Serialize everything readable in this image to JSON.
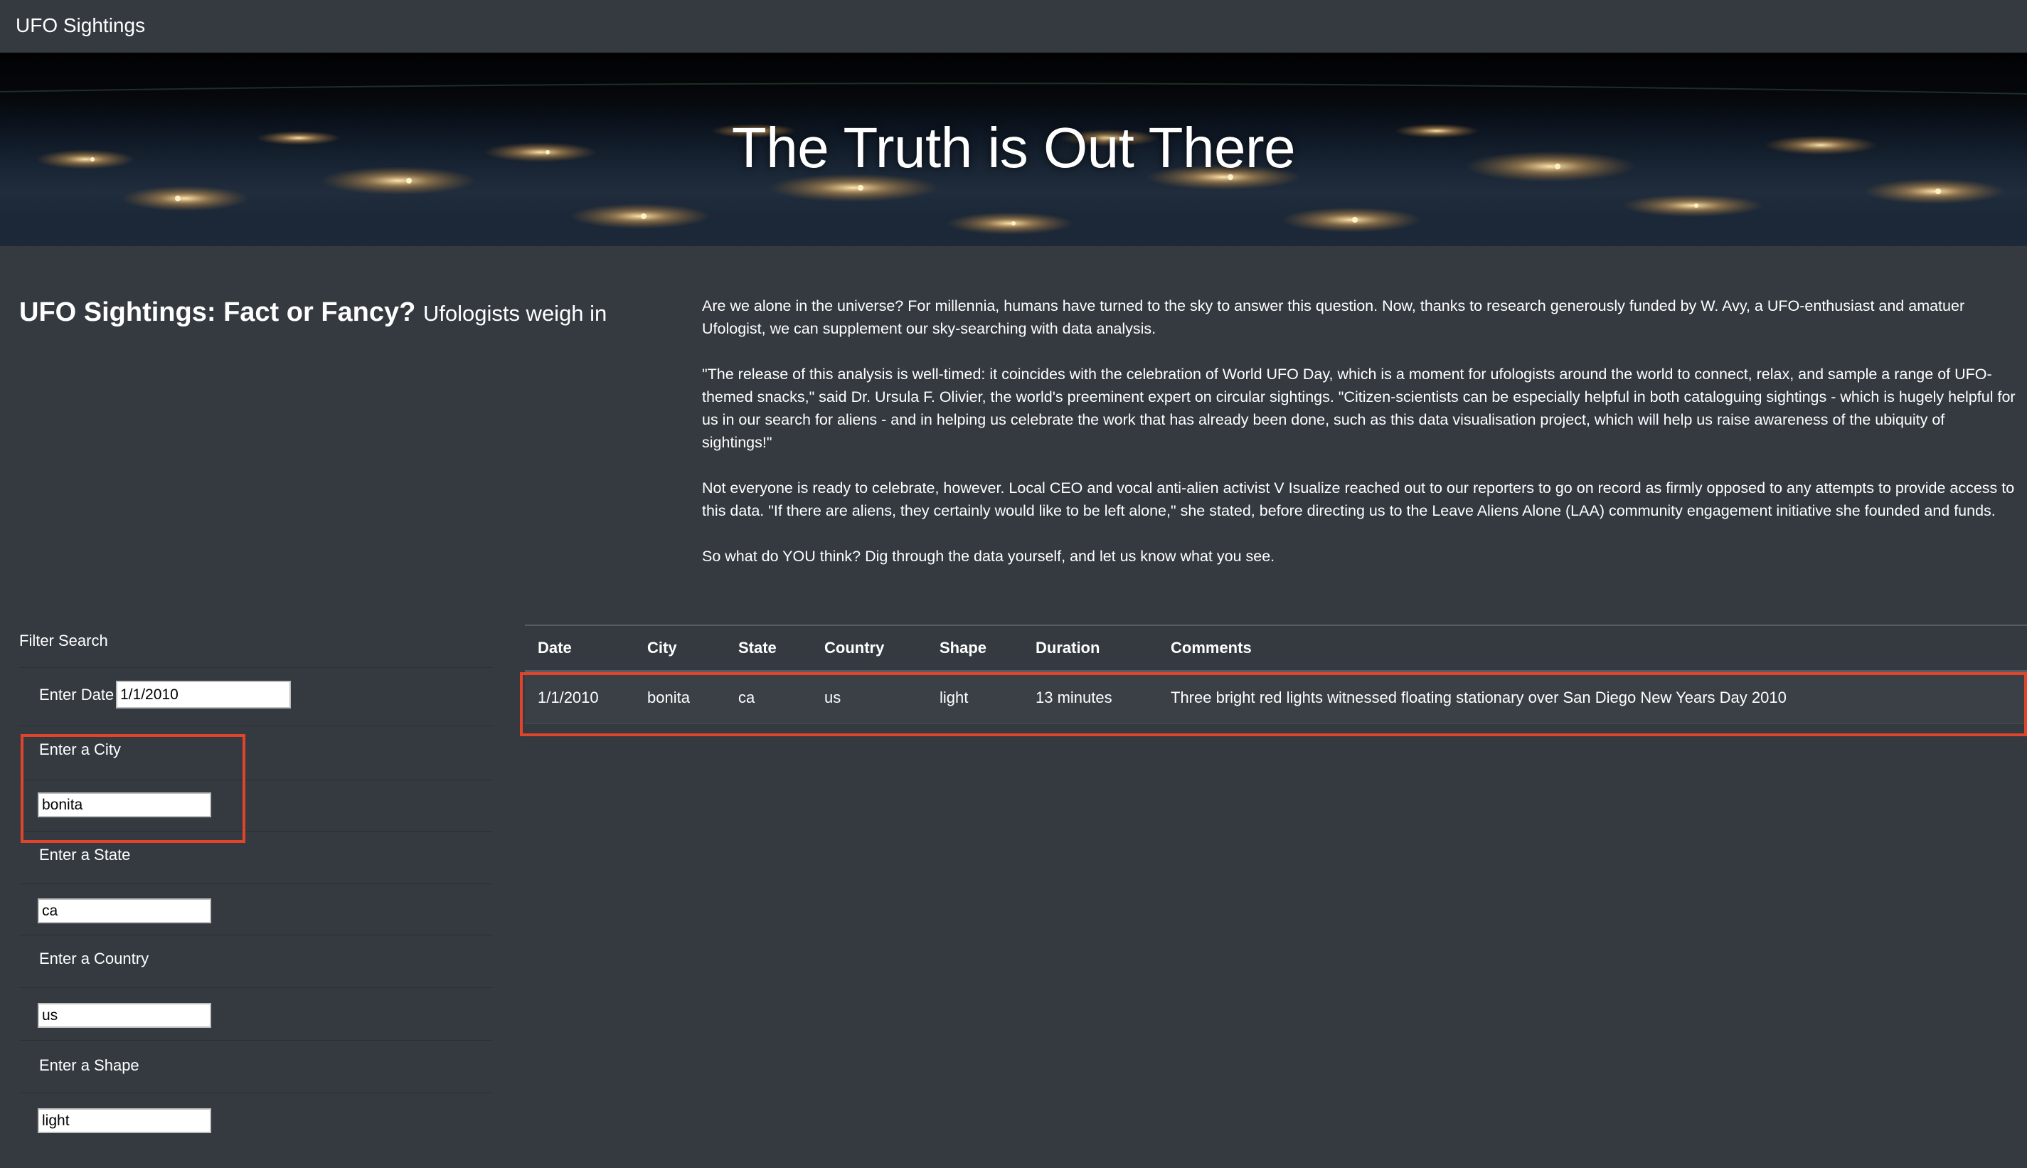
{
  "navbar": {
    "brand": "UFO Sightings"
  },
  "hero": {
    "title": "The Truth is Out There"
  },
  "intro": {
    "heading": "UFO Sightings: Fact or Fancy?",
    "subheading": "Ufologists weigh in",
    "paragraphs": [
      "Are we alone in the universe? For millennia, humans have turned to the sky to answer this question. Now, thanks to research generously funded by W. Avy, a UFO-enthusiast and amatuer Ufologist, we can supplement our sky-searching with data analysis.",
      "\"The release of this analysis is well-timed: it coincides with the celebration of World UFO Day, which is a moment for ufologists around the world to connect, relax, and sample a range of UFO-themed snacks,\" said Dr. Ursula F. Olivier, the world's preeminent expert on circular sightings. \"Citizen-scientists can be especially helpful in both cataloguing sightings - which is hugely helpful for us in our search for aliens - and in helping us celebrate the work that has already been done, such as this data visualisation project, which will help us raise awareness of the ubiquity of sightings!\"",
      "Not everyone is ready to celebrate, however. Local CEO and vocal anti-alien activist V Isualize reached out to our reporters to go on record as firmly opposed to any attempts to provide access to this data. \"If there are aliens, they certainly would like to be left alone,\" she stated, before directing us to the Leave Aliens Alone (LAA) community engagement initiative she founded and funds.",
      "So what do YOU think? Dig through the data yourself, and let us know what you see."
    ]
  },
  "filters": {
    "title": "Filter Search",
    "date": {
      "label": "Enter Date",
      "value": "1/1/2010"
    },
    "city": {
      "label": "Enter a City",
      "value": "bonita"
    },
    "state": {
      "label": "Enter a State",
      "value": "ca"
    },
    "country": {
      "label": "Enter a Country",
      "value": "us"
    },
    "shape": {
      "label": "Enter a Shape",
      "value": "light"
    }
  },
  "table": {
    "headers": [
      "Date",
      "City",
      "State",
      "Country",
      "Shape",
      "Duration",
      "Comments"
    ],
    "rows": [
      [
        "1/1/2010",
        "bonita",
        "ca",
        "us",
        "light",
        "13 minutes",
        "Three bright red lights witnessed floating stationary over San Diego New Years Day 2010"
      ]
    ]
  },
  "colors": {
    "background": "#343a40",
    "highlight": "#e0452b"
  }
}
